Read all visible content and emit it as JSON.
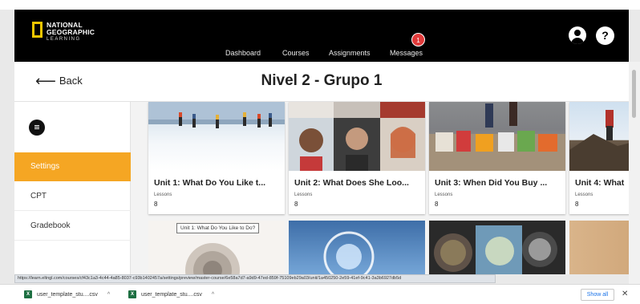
{
  "header": {
    "logo": {
      "line1": "NATIONAL",
      "line2": "GEOGRAPHIC",
      "line3": "LEARNING"
    },
    "nav": [
      {
        "label": "Dashboard"
      },
      {
        "label": "Courses"
      },
      {
        "label": "Assignments"
      },
      {
        "label": "Messages"
      }
    ],
    "messages_badge": "1",
    "help_label": "?"
  },
  "titlebar": {
    "back_label": "Back",
    "title": "Nivel 2 - Grupo 1"
  },
  "sidebar": {
    "items": [
      {
        "label": "Settings",
        "active": true
      },
      {
        "label": "CPT",
        "active": false
      },
      {
        "label": "Gradebook",
        "active": false
      }
    ]
  },
  "cards": [
    {
      "title": "Unit 1: What Do You Like t...",
      "lessons_label": "Lessons",
      "lessons": "8"
    },
    {
      "title": "Unit 2: What Does She Loo...",
      "lessons_label": "Lessons",
      "lessons": "8"
    },
    {
      "title": "Unit 3: When Did You Buy ...",
      "lessons_label": "Lessons",
      "lessons": "8"
    },
    {
      "title": "Unit 4: What",
      "lessons_label": "Lessons",
      "lessons": "8"
    }
  ],
  "tooltip": "Unit 1: What Do You Like to Do?",
  "status_url": "https://learn.eltngl.com/courses/cf43c1a3-4c44-4a85-8037-c93b1402457a/settings/preview/master-course/6e58a7d7-a9d9-47ed-859f-75109eb29a03/unit/1a450250-2e59-41ef-9c41-3a3b6927db5d",
  "downloads": {
    "files": [
      {
        "name": "user_template_stu....csv"
      },
      {
        "name": "user_template_stu....csv"
      }
    ],
    "show_all": "Show all"
  },
  "colors": {
    "header_bg": "#000000",
    "accent": "#f5a623",
    "logo_yellow": "#f2c600",
    "badge_red": "#e03a3a"
  }
}
